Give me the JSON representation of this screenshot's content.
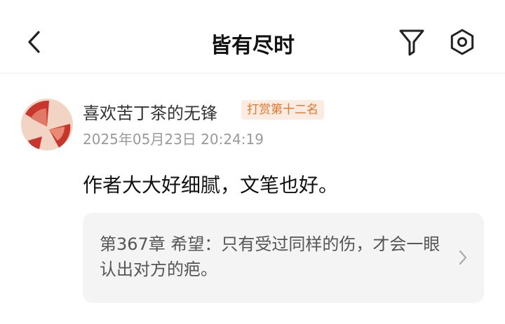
{
  "header": {
    "title": "皆有尽时"
  },
  "comment": {
    "username": "喜欢苦丁茶的无锋",
    "badge": "打赏第十二名",
    "timestamp": "2025年05月23日 20:24:19",
    "content": "作者大大好细腻，文笔也好。",
    "reference": {
      "text": "第367章 希望：只有受过同样的伤，才会一眼认出对方的疤。"
    }
  },
  "colors": {
    "badge_bg": "#fcebe1",
    "badge_text": "#e1772f",
    "avatar_bg": "#f1d4c4",
    "avatar_fan": "#c8352c"
  },
  "icons": {
    "back": "chevron-left-icon",
    "filter": "filter-icon",
    "settings": "settings-gear-icon",
    "reference": "chevron-right-icon"
  }
}
